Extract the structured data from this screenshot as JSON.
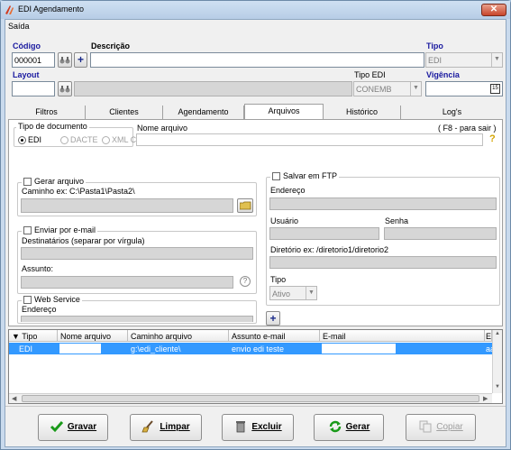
{
  "window": {
    "title": "EDI Agendamento",
    "close_icon": "x-icon"
  },
  "menu": {
    "saida": "Saída"
  },
  "header": {
    "codigo_label": "Código",
    "codigo_value": "000001",
    "descricao_label": "Descrição",
    "descricao_value": "",
    "tipo_label": "Tipo",
    "tipo_value": "EDI",
    "layout_label": "Layout",
    "layout_value": "",
    "tipo_edi_label": "Tipo EDI",
    "tipo_edi_value": "CONEMB",
    "vigencia_label": "Vigência",
    "vigencia_value": ""
  },
  "tabs": [
    {
      "label": "Filtros"
    },
    {
      "label": "Clientes"
    },
    {
      "label": "Agendamento"
    },
    {
      "label": "Arquivos"
    },
    {
      "label": "Histórico"
    },
    {
      "label": "Log's"
    }
  ],
  "arquivos": {
    "tipo_documento_label": "Tipo de documento",
    "radio_edi": "EDI",
    "radio_dacte": "DACTE",
    "radio_xml": "XML CTe",
    "nome_arquivo_label": "Nome arquivo",
    "f8_hint": "( F8 - para sair )",
    "help_icon": "?",
    "gerar_arquivo_label": "Gerar arquivo",
    "caminho_label": "Caminho ex: C:\\Pasta1\\Pasta2\\",
    "enviar_email_label": "Enviar por e-mail",
    "destinatarios_label": "Destinatários (separar por vírgula)",
    "assunto_label": "Assunto:",
    "web_service_label": "Web Service",
    "endereco_ws_label": "Endereço",
    "salvar_ftp_label": "Salvar em FTP",
    "endereco_ftp_label": "Endereço",
    "usuario_label": "Usuário",
    "senha_label": "Senha",
    "diretorio_label": "Diretório ex: /diretorio1/diretorio2",
    "ftp_tipo_label": "Tipo",
    "ftp_tipo_value": "Ativo",
    "add_button": "+"
  },
  "grid": {
    "columns": [
      "Tipo",
      "Nome arquivo",
      "Caminho arquivo",
      "Assunto e-mail",
      "E-mail",
      "Enc"
    ],
    "rows": [
      {
        "tipo": "EDI",
        "nome": "",
        "caminho": "g:\\edi_cliente\\",
        "assunto": "envio edi teste",
        "email": "",
        "enc": "aaa"
      }
    ]
  },
  "actions": {
    "gravar": "Gravar",
    "limpar": "Limpar",
    "excluir": "Excluir",
    "gerar": "Gerar",
    "copiar": "Copiar"
  },
  "colors": {
    "label_blue": "#1a1aa0",
    "selection": "#3399ff",
    "titlebar": "#c9daed"
  }
}
